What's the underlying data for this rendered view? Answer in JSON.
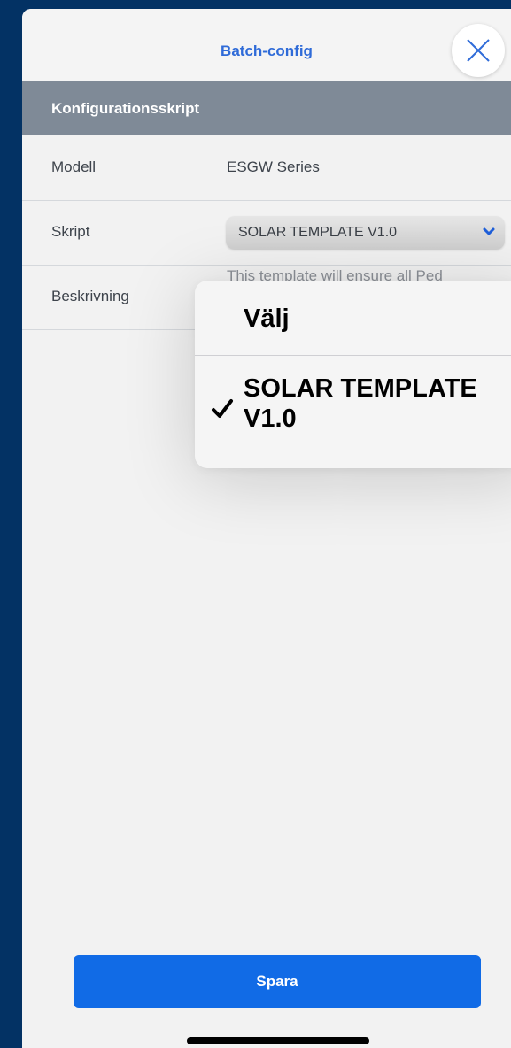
{
  "header": {
    "title": "Batch-config",
    "close_icon": "close-icon"
  },
  "section": {
    "title": "Konfigurationsskript"
  },
  "rows": {
    "model": {
      "label": "Modell",
      "value": "ESGW Series"
    },
    "script": {
      "label": "Skript",
      "selected": "SOLAR TEMPLATE V1.0",
      "icon": "chevron-down-icon"
    },
    "description": {
      "label": "Beskrivning",
      "value": "This template will ensure all Ped"
    }
  },
  "dropdown": {
    "options": [
      {
        "label": "Välj",
        "checked": false
      },
      {
        "label": "SOLAR TEMPLATE V1.0",
        "checked": true
      }
    ],
    "check_icon": "checkmark-icon"
  },
  "footer": {
    "save_label": "Spara"
  },
  "colors": {
    "accent": "#2f6bd8",
    "button": "#116be6",
    "section_bg": "#7f8a97",
    "frame": "#033264"
  }
}
